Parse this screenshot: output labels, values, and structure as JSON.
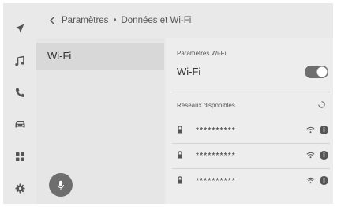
{
  "header": {
    "breadcrumb_parent": "Paramètres",
    "breadcrumb_separator": "•",
    "breadcrumb_current": "Données et Wi-Fi"
  },
  "rail": {
    "items": [
      {
        "icon": "navigation-arrow-icon"
      },
      {
        "icon": "music-note-icon"
      },
      {
        "icon": "phone-icon"
      },
      {
        "icon": "car-icon"
      },
      {
        "icon": "apps-grid-icon"
      },
      {
        "icon": "gear-icon"
      }
    ]
  },
  "left_panel": {
    "selected_item_label": "Wi-Fi"
  },
  "right_panel": {
    "section_wifi_settings": "Paramètres Wi-Fi",
    "wifi_toggle_label": "Wi-Fi",
    "wifi_toggle_on": true,
    "section_available_networks": "Réseaux disponibles",
    "networks": [
      {
        "name": "**********",
        "locked": true
      },
      {
        "name": "**********",
        "locked": true
      },
      {
        "name": "**********",
        "locked": true
      }
    ],
    "info_glyph": "i"
  },
  "colors": {
    "background": "#e9e9e9",
    "selected_item": "#d8d8d8",
    "toggle_on": "#6e6e6e",
    "icon": "#555555"
  }
}
